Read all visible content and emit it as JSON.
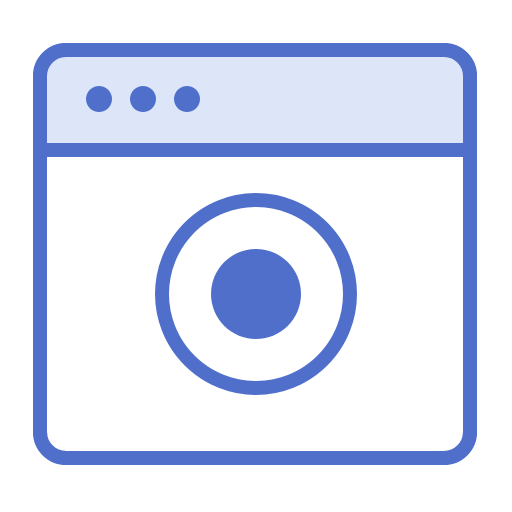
{
  "icon": {
    "name": "browser-window-record-icon",
    "window_controls": [
      "dot",
      "dot",
      "dot"
    ]
  },
  "colors": {
    "stroke": "#4f6fcb",
    "titlebar_fill": "#dce6f8",
    "window_fill": "#ffffff",
    "accent": "#4f6fcb"
  }
}
